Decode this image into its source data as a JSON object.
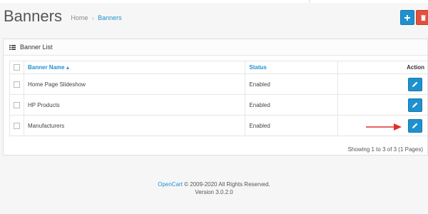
{
  "header": {
    "title": "Banners",
    "breadcrumb": [
      {
        "label": "Home"
      },
      {
        "label": "Banners"
      }
    ],
    "separator": "›",
    "add_icon": "plus-icon",
    "delete_icon": "trash-icon",
    "colors": {
      "primary": "#1e91cf",
      "danger": "#e3503e"
    }
  },
  "panel": {
    "title": "Banner List",
    "icon": "list-icon"
  },
  "table": {
    "columns": {
      "name": "Banner Name",
      "status": "Status",
      "action": "Action"
    },
    "sort_indicator": "▴",
    "rows": [
      {
        "name": "Home Page Slideshow",
        "status": "Enabled"
      },
      {
        "name": "HP Products",
        "status": "Enabled"
      },
      {
        "name": "Manufacturers",
        "status": "Enabled"
      }
    ],
    "edit_icon": "pencil-icon"
  },
  "pagination": {
    "info": "Showing 1 to 3 of 3 (1 Pages)"
  },
  "annotation": {
    "arrow_color": "#e0302a"
  },
  "footer": {
    "brand": "OpenCart",
    "copyright": " © 2009-2020 All Rights Reserved.",
    "version": "Version 3.0.2.0"
  }
}
